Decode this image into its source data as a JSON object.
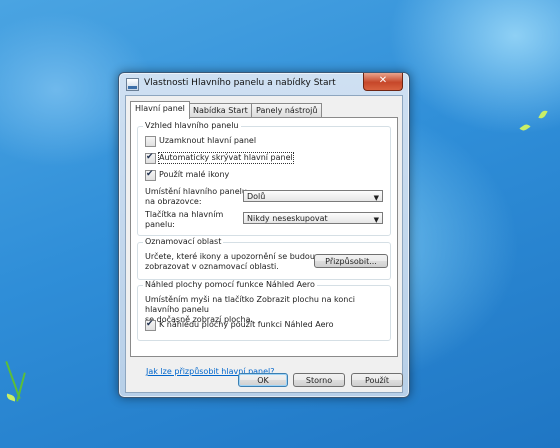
{
  "window": {
    "title": "Vlastnosti Hlavního panelu a nabídky Start",
    "close_label": "✕"
  },
  "tabs": [
    {
      "label": "Hlavní panel",
      "active": true
    },
    {
      "label": "Nabídka Start",
      "active": false
    },
    {
      "label": "Panely nástrojů",
      "active": false
    }
  ],
  "appearance": {
    "title": "Vzhled hlavního panelu",
    "lock": {
      "label": "Uzamknout hlavní panel",
      "checked": false
    },
    "autohide": {
      "label": "Automaticky skrývat hlavní panel",
      "checked": true
    },
    "small_icons": {
      "label": "Použít malé ikony",
      "checked": true
    },
    "location": {
      "label_line1": "Umístění hlavního panelu",
      "label_line2": "na obrazovce:",
      "value": "Dolů"
    },
    "buttons": {
      "label_line1": "Tlačítka na hlavním",
      "label_line2": "panelu:",
      "value": "Nikdy neseskupovat"
    }
  },
  "notification": {
    "title": "Oznamovací oblast",
    "text_line1": "Určete, které ikony a upozornění se budou",
    "text_line2": "zobrazovat v oznamovací oblasti.",
    "customize_label": "Přizpůsobit..."
  },
  "aero_peek": {
    "title": "Náhled plochy pomocí funkce Náhled Aero",
    "text_line1": "Umístěním myši na tlačítko Zobrazit plochu na konci hlavního panelu",
    "text_line2": "se dočasně zobrazí plocha.",
    "checkbox": {
      "label": "K náhledu plochy použít funkci Náhled Aero",
      "checked": true
    }
  },
  "help_link": "Jak lze přizpůsobit hlavní panel?",
  "buttons": {
    "ok": "OK",
    "cancel": "Storno",
    "apply": "Použít"
  },
  "colors": {
    "desktop": "#2d8bd4",
    "link": "#0066cc",
    "close": "#c6472a"
  }
}
